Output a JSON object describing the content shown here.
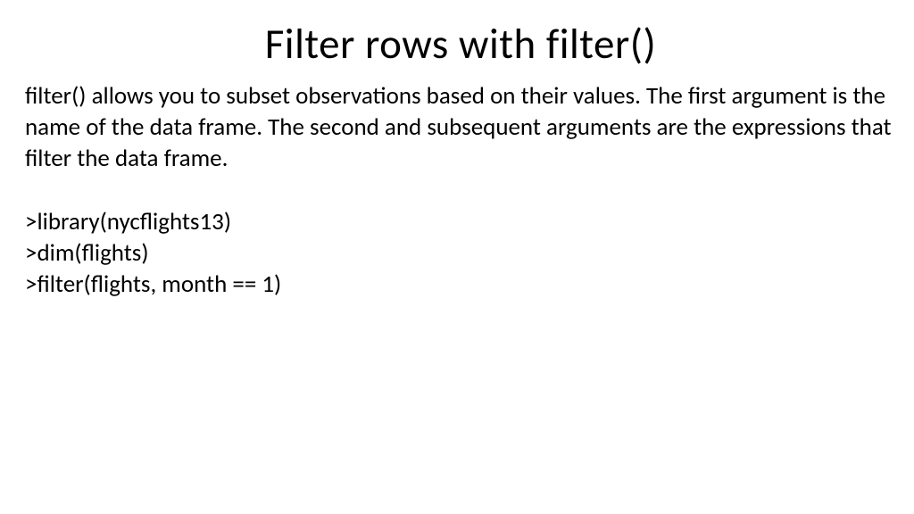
{
  "title": "Filter rows with filter()",
  "description": "filter() allows you to subset observations based on their values. The first argument is the name of the data frame. The second and subsequent arguments are the expressions that filter the data frame.",
  "code": {
    "line1": ">library(nycflights13)",
    "line2": ">dim(flights)",
    "line3": ">filter(flights, month == 1)"
  }
}
